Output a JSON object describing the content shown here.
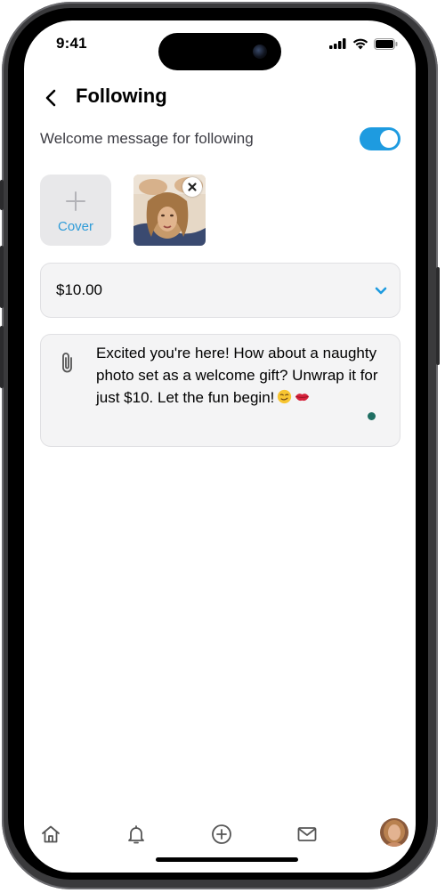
{
  "status_bar": {
    "time": "9:41"
  },
  "header": {
    "title": "Following",
    "back_icon": "chevron-left-icon"
  },
  "welcome": {
    "label": "Welcome message for following",
    "enabled": true
  },
  "media": {
    "cover_label": "Cover",
    "cover_icon": "plus-icon",
    "attached_count": 1,
    "remove_icon": "close-icon"
  },
  "price": {
    "selected": "$10.00",
    "chevron_icon": "chevron-down-icon"
  },
  "message": {
    "text": "Excited you're here! How about a naughty photo set as a welcome gift? Unwrap it for just $10. Let the fun begin!",
    "emojis": [
      "smirk-emoji",
      "kiss-lips-emoji"
    ],
    "attach_icon": "paperclip-icon"
  },
  "tabbar": {
    "items": [
      "home-icon",
      "bell-icon",
      "plus-circle-icon",
      "mail-icon",
      "avatar"
    ]
  },
  "colors": {
    "accent": "#1e9be0",
    "cover_text": "#2d9bd8",
    "field_bg": "#f4f4f5",
    "typing_dot": "#1f6e62"
  }
}
